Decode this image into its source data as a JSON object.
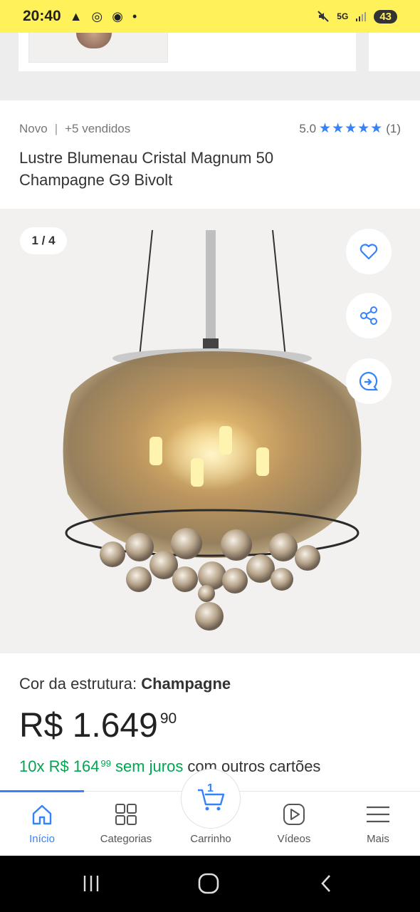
{
  "status_bar": {
    "time": "20:40",
    "left_icons": "▲ ◎ ◉ •",
    "network": "5G",
    "battery": "43"
  },
  "product": {
    "condition": "Novo",
    "sold": "+5 vendidos",
    "rating_value": "5.0",
    "stars": "★★★★★",
    "review_count": "(1)",
    "rating": 5,
    "title": "Lustre Blumenau Cristal Magnum 50 Champagne G9 Bivolt"
  },
  "gallery": {
    "counter": "1 / 4",
    "actions": [
      "favorite",
      "share",
      "compare"
    ]
  },
  "details": {
    "structure_label": "Cor da estrutura:",
    "structure_value": "Champagne",
    "price_main": "R$ 1.649",
    "price_cents": "90",
    "installments_prefix": "10x R$ 164",
    "installments_cents": "99",
    "installments_suffix": "sem juros",
    "installments_other": "com outros cartões"
  },
  "bottom_nav": {
    "items": [
      {
        "label": "Início",
        "icon": "home-icon",
        "active": true
      },
      {
        "label": "Categorias",
        "icon": "grid-icon"
      },
      {
        "label": "Carrinho",
        "icon": "cart-icon",
        "badge": "1"
      },
      {
        "label": "Vídeos",
        "icon": "play-icon"
      },
      {
        "label": "Mais",
        "icon": "menu-icon"
      }
    ]
  },
  "colors": {
    "header_yellow": "#fff159",
    "accent_blue": "#3483fa",
    "green": "#00a650"
  }
}
